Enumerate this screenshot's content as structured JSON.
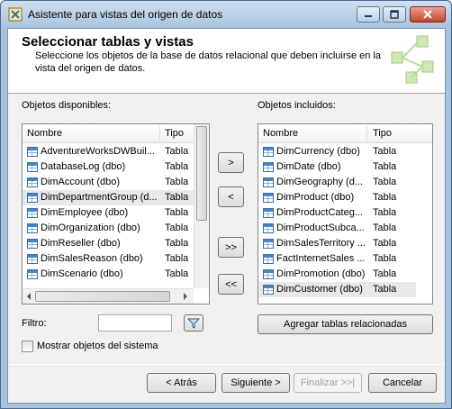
{
  "window": {
    "title": "Asistente para vistas del origen de datos"
  },
  "header": {
    "title": "Seleccionar tablas y vistas",
    "description": "Seleccione los objetos de la base de datos relacional que deben incluirse en la vista del origen de datos."
  },
  "available": {
    "label": "Objetos disponibles:",
    "col_name": "Nombre",
    "col_type": "Tipo",
    "rows": [
      {
        "name": "AdventureWorksDWBuil...",
        "type": "Tabla"
      },
      {
        "name": "DatabaseLog (dbo)",
        "type": "Tabla"
      },
      {
        "name": "DimAccount (dbo)",
        "type": "Tabla"
      },
      {
        "name": "DimDepartmentGroup (d...",
        "type": "Tabla"
      },
      {
        "name": "DimEmployee (dbo)",
        "type": "Tabla"
      },
      {
        "name": "DimOrganization (dbo)",
        "type": "Tabla"
      },
      {
        "name": "DimReseller (dbo)",
        "type": "Tabla"
      },
      {
        "name": "DimSalesReason (dbo)",
        "type": "Tabla"
      },
      {
        "name": "DimScenario (dbo)",
        "type": "Tabla"
      }
    ]
  },
  "included": {
    "label": "Objetos incluidos:",
    "col_name": "Nombre",
    "col_type": "Tipo",
    "rows": [
      {
        "name": "DimCurrency (dbo)",
        "type": "Tabla"
      },
      {
        "name": "DimDate (dbo)",
        "type": "Tabla"
      },
      {
        "name": "DimGeography (d...",
        "type": "Tabla"
      },
      {
        "name": "DimProduct (dbo)",
        "type": "Tabla"
      },
      {
        "name": "DimProductCateg...",
        "type": "Tabla"
      },
      {
        "name": "DimProductSubca...",
        "type": "Tabla"
      },
      {
        "name": "DimSalesTerritory ...",
        "type": "Tabla"
      },
      {
        "name": "FactInternetSales ...",
        "type": "Tabla"
      },
      {
        "name": "DimPromotion (dbo)",
        "type": "Tabla"
      },
      {
        "name": "DimCustomer (dbo)",
        "type": "Tabla"
      }
    ]
  },
  "transfer": {
    "add_one": ">",
    "remove_one": "<",
    "add_all": ">>",
    "remove_all": "<<"
  },
  "filter": {
    "label": "Filtro:",
    "value": ""
  },
  "related_button": "Agregar tablas relacionadas",
  "show_system": {
    "label": "Mostrar objetos del sistema",
    "checked": false
  },
  "nav": {
    "back": "< Atrás",
    "next": "Siguiente >",
    "finish": "Finalizar >>|",
    "cancel": "Cancelar"
  },
  "colors": {
    "title_bar": "#a8c3df",
    "client_bg": "#f0f0f0",
    "selection": "#e8e8e8",
    "table_icon": "#3a6ea5"
  }
}
